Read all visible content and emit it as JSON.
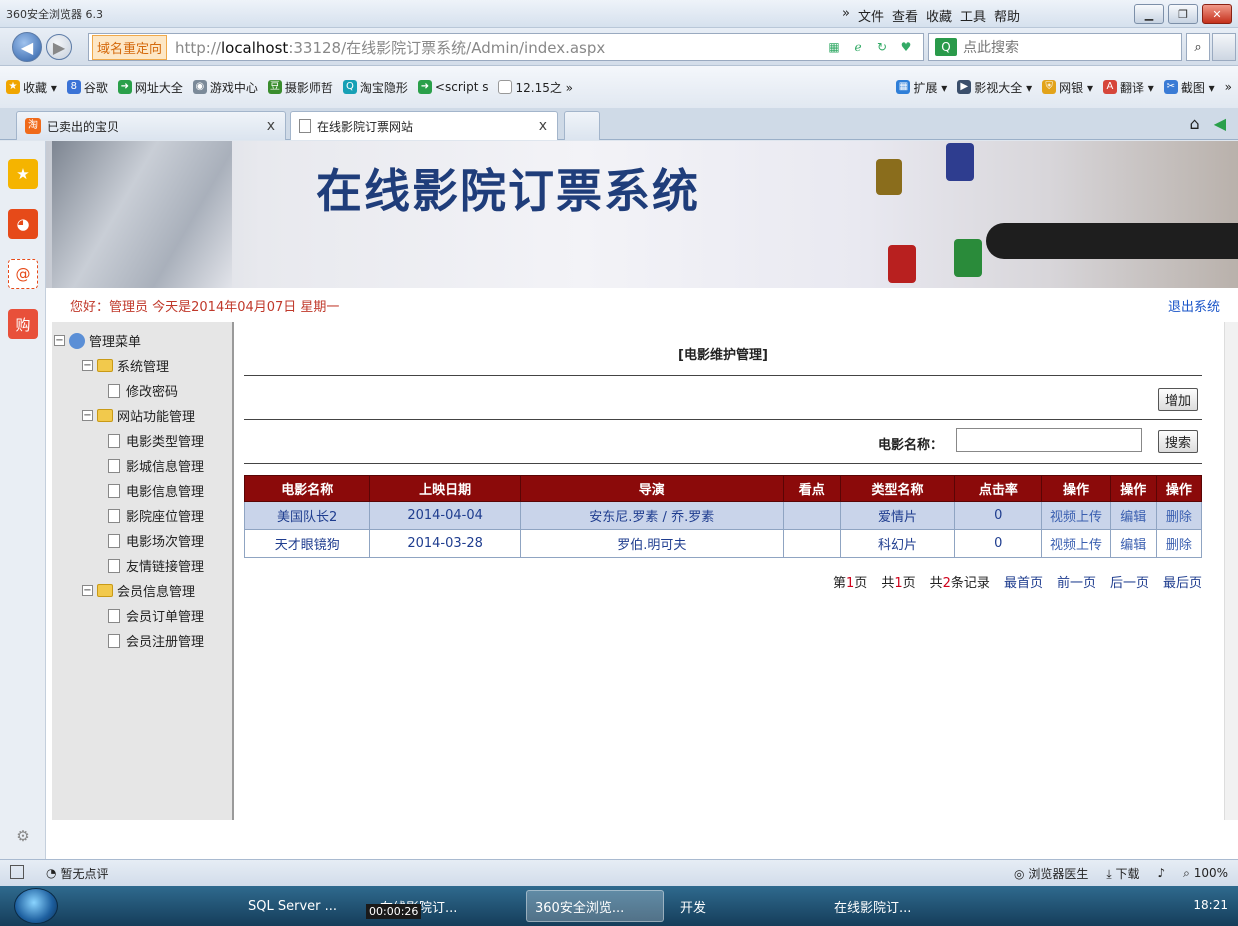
{
  "browser": {
    "title": "360安全浏览器 6.3",
    "menu": [
      "»",
      "文件",
      "查看",
      "收藏",
      "工具",
      "帮助"
    ],
    "redirect_label": "域名重定向",
    "url_prefix": "http://",
    "url_host": "localhost",
    "url_rest": ":33128/在线影院订票系统/Admin/index.aspx",
    "search_placeholder": "点此搜索",
    "bookmarks": [
      "收藏 ▾",
      "谷歌",
      "网址大全",
      "游戏中心",
      "摄影师哲",
      "淘宝隐形",
      "<script s",
      "12.15之 »"
    ],
    "bookmarks_right": [
      "扩展 ▾",
      "影视大全 ▾",
      "网银 ▾",
      "翻译 ▾",
      "截图 ▾",
      "»"
    ],
    "tabs": [
      {
        "label": "已卖出的宝贝",
        "close": "x"
      },
      {
        "label": "在线影院订票网站",
        "close": "x"
      }
    ]
  },
  "site": {
    "title": "在线影院订票系统",
    "greeting": "您好：管理员  今天是2014年04月07日  星期一",
    "logout": "退出系统"
  },
  "tree": {
    "root": "管理菜单",
    "groups": [
      {
        "label": "系统管理",
        "items": [
          "修改密码"
        ]
      },
      {
        "label": "网站功能管理",
        "items": [
          "电影类型管理",
          "影城信息管理",
          "电影信息管理",
          "影院座位管理",
          "电影场次管理",
          "友情链接管理"
        ]
      },
      {
        "label": "会员信息管理",
        "items": [
          "会员订单管理",
          "会员注册管理"
        ]
      }
    ]
  },
  "main": {
    "title": "[电影维护管理]",
    "add_button": "增加",
    "search_label": "电影名称：",
    "search_value": "",
    "search_button": "搜索",
    "columns": [
      "电影名称",
      "上映日期",
      "导演",
      "看点",
      "类型名称",
      "点击率",
      "操作",
      "操作",
      "操作"
    ],
    "rows": [
      {
        "name": "美国队长2",
        "date": "2014-04-04",
        "director": "安东尼.罗素 / 乔.罗素",
        "highlight": "",
        "type": "爱情片",
        "clicks": "0",
        "op1": "视频上传",
        "op2": "编辑",
        "op3": "删除"
      },
      {
        "name": "天才眼镜狗",
        "date": "2014-03-28",
        "director": "罗伯.明可夫",
        "highlight": "",
        "type": "科幻片",
        "clicks": "0",
        "op1": "视频上传",
        "op2": "编辑",
        "op3": "删除"
      }
    ],
    "pager": {
      "page_prefix": "第",
      "page_num": "1",
      "page_suffix": "页",
      "total_prefix": "共",
      "total_num": "1",
      "total_suffix": "页",
      "rec_prefix": "共",
      "rec_num": "2",
      "rec_suffix": "条记录",
      "first": "最首页",
      "prev": "前一页",
      "next": "后一页",
      "last": "最后页"
    }
  },
  "status": {
    "left": "暂无点评",
    "right": [
      "浏览器医生",
      "下载",
      "100%"
    ]
  },
  "taskbar": {
    "tasks": [
      "SQL Server ...",
      "在线影院订...",
      "360安全浏览...",
      "开发",
      "在线影院订..."
    ],
    "timer": "00:00:26",
    "clock": "18:21"
  }
}
